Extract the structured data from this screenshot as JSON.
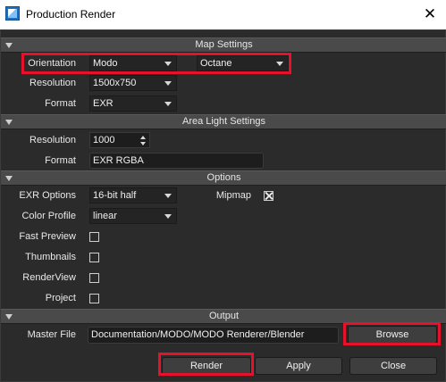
{
  "window": {
    "title": "Production Render",
    "close_glyph": "✕",
    "icon": "app-icon"
  },
  "map_settings": {
    "header": "Map Settings",
    "orientation_label": "Orientation",
    "orientation_value": "Modo",
    "renderer_value": "Octane",
    "resolution_label": "Resolution",
    "resolution_value": "1500x750",
    "format_label": "Format",
    "format_value": "EXR"
  },
  "area_light_settings": {
    "header": "Area Light Settings",
    "resolution_label": "Resolution",
    "resolution_value": "1000",
    "format_label": "Format",
    "format_value": "EXR RGBA"
  },
  "options": {
    "header": "Options",
    "exr_options_label": "EXR Options",
    "exr_options_value": "16-bit half",
    "mipmap_label": "Mipmap",
    "mipmap_checked": true,
    "color_profile_label": "Color Profile",
    "color_profile_value": "linear",
    "fast_preview_label": "Fast Preview",
    "fast_preview_checked": false,
    "thumbnails_label": "Thumbnails",
    "thumbnails_checked": false,
    "renderview_label": "RenderView",
    "renderview_checked": false,
    "project_label": "Project",
    "project_checked": false
  },
  "output": {
    "header": "Output",
    "master_file_label": "Master File",
    "master_file_value": "Documentation/MODO/MODO Renderer/Blender",
    "browse_label": "Browse"
  },
  "footer": {
    "render_label": "Render",
    "apply_label": "Apply",
    "close_label": "Close"
  },
  "colors": {
    "highlight": "#e8102a",
    "background": "#2b2b2b",
    "section_header": "#4a4a4a"
  }
}
